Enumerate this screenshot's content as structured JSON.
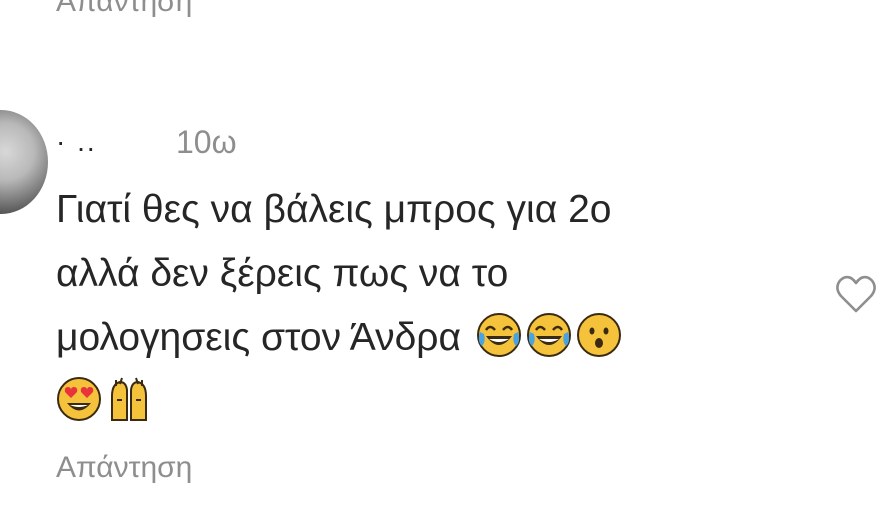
{
  "comment": {
    "username": "· ..",
    "time": "10ω",
    "text": "Γιατί θες να βάλεις μπρος για 2ο\nαλλά δεν ξέρεις πως να το\nμολογησεις στον Άνδρα ",
    "emojis": [
      "joy",
      "joy",
      "hushed",
      "heart-eyes",
      "raising-hands"
    ]
  },
  "actions": {
    "reply_label_top": "Απάντηση",
    "reply_label_bottom": "Απάντηση"
  },
  "icons": {
    "like": "heart-outline-icon"
  },
  "colors": {
    "text": "#262626",
    "secondary": "#8e8e8e",
    "background": "#ffffff"
  }
}
